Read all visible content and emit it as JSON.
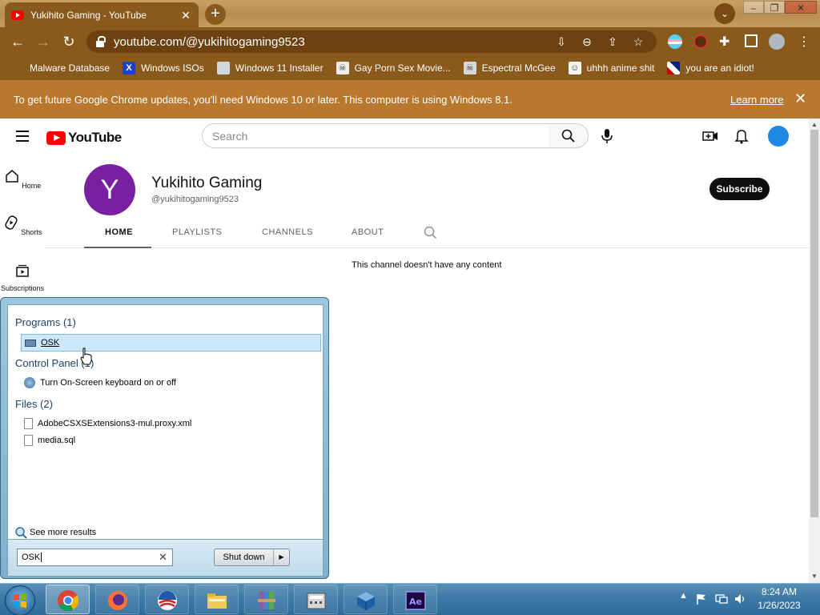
{
  "browser": {
    "tab_title": "Yukihito Gaming - YouTube",
    "url": "youtube.com/@yukihitogaming9523",
    "bookmarks": [
      {
        "label": "Malware Database",
        "icon": "yellow-icon",
        "color": "#f4c542"
      },
      {
        "label": "Windows ISOs",
        "icon": "x-icon",
        "color": "#1a44c4"
      },
      {
        "label": "Windows 11 Installer",
        "icon": "image-icon",
        "color": "#cfd8dc"
      },
      {
        "label": "Gay Porn Sex Movie...",
        "icon": "skull-icon",
        "color": "#eeeeee"
      },
      {
        "label": "Espectral McGee",
        "icon": "skull-icon",
        "color": "#d8d8d8"
      },
      {
        "label": "uhhh anime shit",
        "icon": "anime-icon",
        "color": "#f5f5f5"
      },
      {
        "label": "you are an idiot!",
        "icon": "flag-icon",
        "color": "#e0e0e0"
      }
    ],
    "infobar_text": "To get future Google Chrome updates, you'll need Windows 10 or later. This computer is using Windows 8.1.",
    "infobar_link": "Learn more"
  },
  "youtube": {
    "logo_text": "YouTube",
    "search_placeholder": "Search",
    "sidebar": [
      {
        "label": "Home"
      },
      {
        "label": "Shorts"
      },
      {
        "label": "Subscriptions"
      }
    ],
    "channel": {
      "avatar_letter": "Y",
      "name": "Yukihito Gaming",
      "handle": "@yukihitogaming9523",
      "subscribe_label": "Subscribe",
      "tabs": [
        "HOME",
        "PLAYLISTS",
        "CHANNELS",
        "ABOUT"
      ],
      "empty_message": "This channel doesn't have any content"
    }
  },
  "start_menu": {
    "programs_header": "Programs (1)",
    "programs": [
      "OSK"
    ],
    "control_panel_header": "Control Panel (1)",
    "control_panel": [
      "Turn On-Screen keyboard on or off"
    ],
    "files_header": "Files (2)",
    "files": [
      "AdobeCSXSExtensions3-mul.proxy.xml",
      "media.sql"
    ],
    "see_more": "See more results",
    "search_value": "OSK",
    "shutdown_label": "Shut down"
  },
  "taskbar": {
    "apps": [
      "chrome-icon",
      "firefox-icon",
      "obama-icon",
      "explorer-icon",
      "winrar-icon",
      "calculator-icon",
      "virtualbox-icon",
      "after-effects-icon"
    ],
    "time": "8:24 AM",
    "date": "1/26/2023"
  }
}
